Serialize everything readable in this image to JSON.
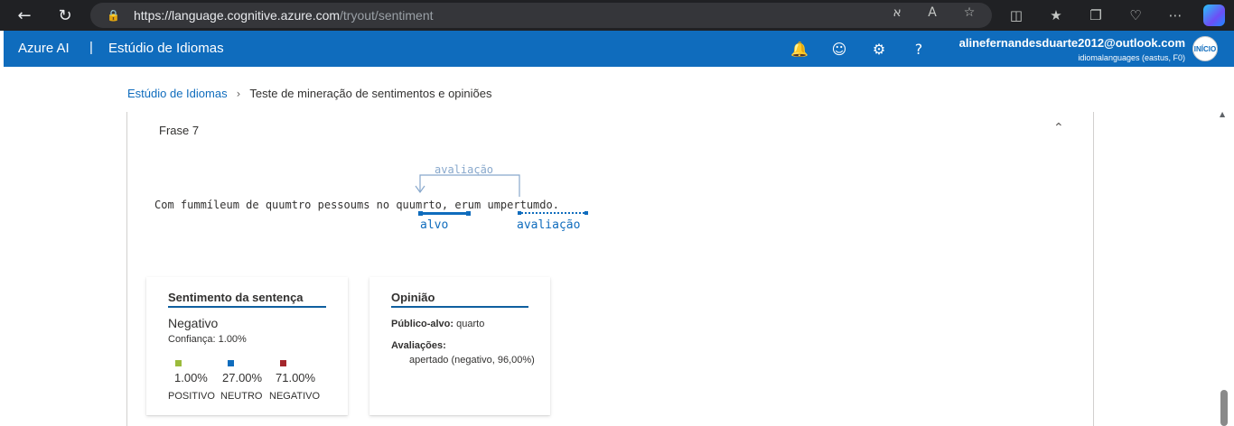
{
  "browser": {
    "url_host": "https://language.cognitive.azure.com",
    "url_path": "/tryout/sentiment"
  },
  "header": {
    "brand": "Azure AI",
    "divider": "|",
    "studio": "Estúdio de Idiomas",
    "user_email": "alinefernandesduarte2012@outlook.com",
    "user_resource": "idiomalanguages (eastus, F0)",
    "avatar_text": "INÍCIO"
  },
  "breadcrumb": {
    "root": "Estúdio de Idiomas",
    "current": "Teste de mineração de sentimentos e opiniões"
  },
  "panel": {
    "title": "Frase 7",
    "sentence": {
      "before": "Com fummíleum de quumtro pessoums no ",
      "target": "quumrto",
      "middle": ", erum ",
      "assessment": "umpertumdo",
      "after": "."
    },
    "arc_label": "avaliação",
    "target_label": "alvo",
    "assessment_label": "avaliação"
  },
  "sentiment_card": {
    "title": "Sentimento da sentença",
    "label": "Negativo",
    "confidence": "Confiança: 1.00%",
    "scores": [
      {
        "name": "POSITIVO",
        "value": "1.00%",
        "color": "#9bbb3c"
      },
      {
        "name": "NEUTRO",
        "value": "27.00%",
        "color": "#0f6cbd"
      },
      {
        "name": "NEGATIVO",
        "value": "71.00%",
        "color": "#a4262c"
      }
    ]
  },
  "opinion_card": {
    "title": "Opinião",
    "target_key": "Público-alvo:",
    "target_value": "quarto",
    "assessments_key": "Avaliações:",
    "assessment_value": "apertado (negativo, 96,00%)"
  }
}
